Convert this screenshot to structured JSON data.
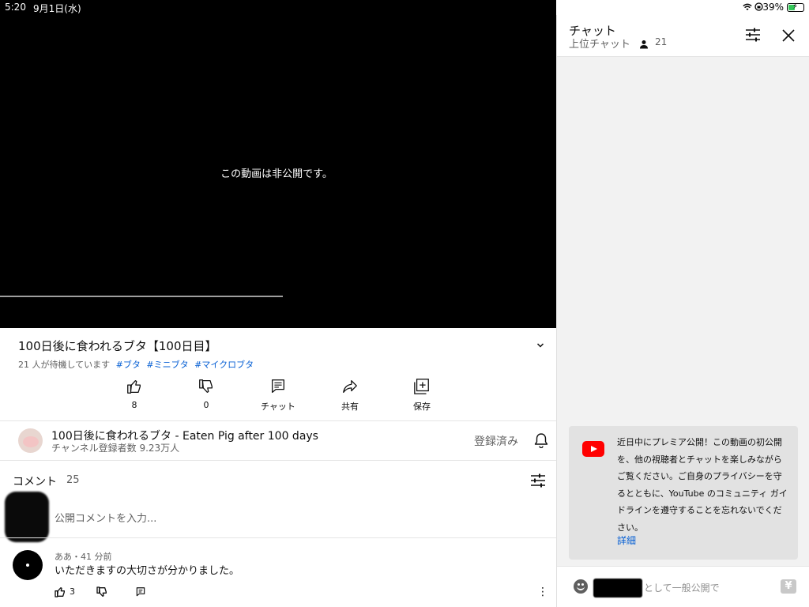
{
  "status_bar": {
    "time": "5:20",
    "date": "9月1日(水)",
    "battery_percent": "39%"
  },
  "player": {
    "message": "この動画は非公開です。",
    "progress_fraction": 0.51
  },
  "video": {
    "title": "100日後に食われるブタ【100日目】",
    "waiting": "21 人が待機しています",
    "hashtags": [
      "#ブタ",
      "#ミニブタ",
      "#マイクロブタ"
    ]
  },
  "actions": {
    "like_count": "8",
    "dislike_count": "0",
    "chat_label": "チャット",
    "share_label": "共有",
    "save_label": "保存"
  },
  "channel": {
    "name": "100日後に食われるブタ  - Eaten Pig after 100 days",
    "subscribers": "チャンネル登録者数 9.23万人",
    "subscribed_label": "登録済み"
  },
  "comments": {
    "heading": "コメント",
    "count": "25",
    "input_placeholder": "公開コメントを入力...",
    "items": [
      {
        "author_time": "ああ・41 分前",
        "text": "いただきますの大切さが分かりました。",
        "likes": "3"
      }
    ]
  },
  "chat": {
    "title": "チャット",
    "mode": "上位チャット",
    "viewers": "21",
    "notice": "近日中にプレミア公開！この動画の初公開を、他の視聴者とチャットを楽しみながらご覧ください。ご自身のプライバシーを守るとともに、YouTube のコミュニティ ガイドラインを遵守することを忘れないでください。",
    "notice_link": "詳細",
    "input_placeholder": "として一般公開で",
    "superchat_symbol": "¥"
  },
  "colors": {
    "accent_link": "#065fd4",
    "youtube_red": "#ff0000",
    "battery_green": "#34c759"
  }
}
